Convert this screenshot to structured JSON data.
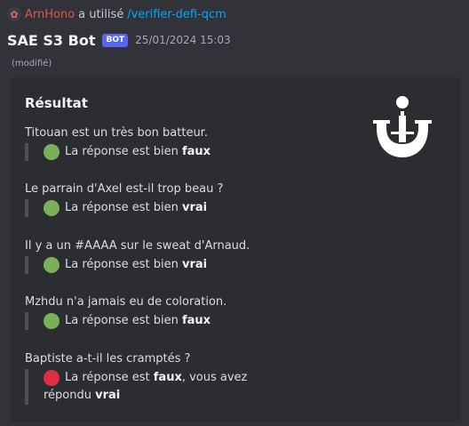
{
  "reply": {
    "user": "ArnHono",
    "used_text": "a utilisé",
    "command": "/verifier-defi-qcm"
  },
  "message": {
    "bot_name": "SAE S3 Bot",
    "badge": "BOT",
    "timestamp": "25/01/2024 15:03",
    "edited": "(modifié)"
  },
  "embed": {
    "title": "Résultat",
    "thumbnail_icon": "anchor-logo-icon",
    "questions": [
      {
        "question": "Titouan est un très bon batteur.",
        "status": "correct",
        "prefix": "La réponse est bien",
        "answer": "faux"
      },
      {
        "question": "Le parrain d'Axel est-il trop beau ?",
        "status": "correct",
        "prefix": "La réponse est bien",
        "answer": "vrai"
      },
      {
        "question": "Il y a un #AAAA sur le sweat d'Arnaud.",
        "status": "correct",
        "prefix": "La réponse est bien",
        "answer": "vrai"
      },
      {
        "question": "Mzhdu n'a jamais eu de coloration.",
        "status": "correct",
        "prefix": "La réponse est bien",
        "answer": "faux"
      },
      {
        "question": "Baptiste a-t-il les cramptés ?",
        "status": "wrong",
        "prefix": "La réponse est",
        "answer": "faux",
        "middle": ", vous avez",
        "line2_prefix": "répondu",
        "user_answer": "vrai"
      }
    ]
  },
  "colors": {
    "background": "#313338",
    "embed_background": "#2b2d31",
    "correct_dot": "#79b15a",
    "wrong_dot": "#dd2e44",
    "command": "#00a8fc",
    "user": "#e0524d",
    "badge": "#5865f2"
  }
}
